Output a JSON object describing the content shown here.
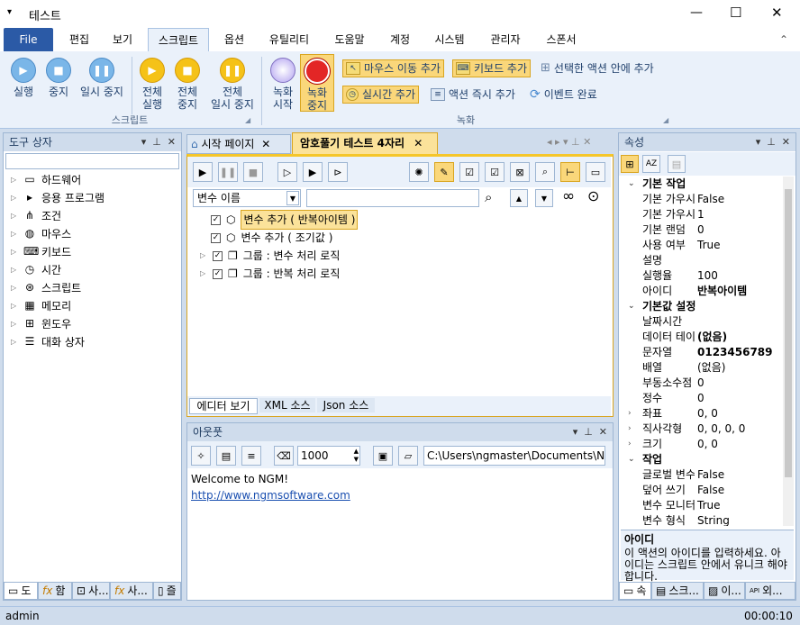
{
  "window": {
    "title": "테스트",
    "menu_glyph": "▾",
    "min": "—",
    "max": "☐",
    "close": "✕"
  },
  "ribbon_tabs": {
    "file": "File",
    "edit": "편집",
    "view": "보기",
    "script": "스크립트",
    "options": "옵션",
    "utility": "유틸리티",
    "help": "도움말",
    "account": "계정",
    "system": "시스템",
    "admin": "관리자",
    "sponsor": "스폰서",
    "collapse": "⌃"
  },
  "ribbon": {
    "run": "실행",
    "stop": "중지",
    "pause": "일시 중지",
    "all_run": [
      "전체",
      "실행"
    ],
    "all_stop": [
      "전체",
      "중지"
    ],
    "all_pause": [
      "전체",
      "일시 중지"
    ],
    "script_group": "스크립트",
    "rec_start": [
      "녹화",
      "시작"
    ],
    "rec_stop": [
      "녹화",
      "중지"
    ],
    "add_mouse": "마우스 이동 추가",
    "add_key": "키보드 추가",
    "add_after": "선택한 액션 안에 추가",
    "add_realtime": "실시간 추가",
    "action_now": "액션 즉시 추가",
    "event_done": "이벤트 완료",
    "rec_group": "녹화"
  },
  "toolbox": {
    "title": "도구 상자",
    "items": [
      "하드웨어",
      "응용 프로그램",
      "조건",
      "마우스",
      "키보드",
      "시간",
      "스크립트",
      "메모리",
      "윈도우",
      "대화 상자"
    ],
    "bottom_tabs": [
      "도",
      "함",
      "사...",
      "사...",
      "즐"
    ]
  },
  "doc_tabs": {
    "start": "시작 페이지",
    "active": "암호풀기 테스트 4자리"
  },
  "editor": {
    "var_select": "변수 이름",
    "search_value": "",
    "nodes": [
      {
        "label": "변수 추가 ( 반복아이템 )",
        "selected": true
      },
      {
        "label": "변수 추가 ( 조기값 )"
      },
      {
        "label": "그룹 : 변수 처리 로직"
      },
      {
        "label": "그룹 : 반복 처리 로직"
      }
    ],
    "tabs": [
      "에디터 보기",
      "XML 소스",
      "Json 소스"
    ]
  },
  "output": {
    "title": "아웃풋",
    "count": "1000",
    "path": "C:\\Users\\ngmaster\\Documents\\NGM",
    "lines": [
      "Welcome to NGM!"
    ],
    "link": "http://www.ngmsoftware.com"
  },
  "properties": {
    "title": "속성",
    "categories": [
      {
        "name": "기본 작업",
        "rows": [
          [
            "기본 가우시",
            "False"
          ],
          [
            "기본 가우시",
            "1"
          ],
          [
            "기본 랜덤",
            "0"
          ],
          [
            "사용 여부",
            "True"
          ],
          [
            "설명",
            ""
          ],
          [
            "실행율",
            "100"
          ],
          [
            "아이디",
            "반복아이템"
          ]
        ]
      },
      {
        "name": "기본값 설정",
        "rows": [
          [
            "날짜시간",
            ""
          ],
          [
            "데이터 테이",
            "(없음)"
          ],
          [
            "문자열",
            "0123456789"
          ],
          [
            "배열",
            "(없음)"
          ],
          [
            "부동소수점",
            "0"
          ],
          [
            "정수",
            "0"
          ],
          [
            "좌표",
            "0, 0"
          ],
          [
            "직사각형",
            "0, 0, 0, 0"
          ],
          [
            "크기",
            "0, 0"
          ]
        ]
      },
      {
        "name": "작업",
        "rows": [
          [
            "글로벌 변수",
            "False"
          ],
          [
            "덮어 쓰기",
            "False"
          ],
          [
            "변수 모니터",
            "True"
          ],
          [
            "변수 형식",
            "String"
          ]
        ]
      }
    ],
    "desc_title": "아이디",
    "desc_text": "이 액션의 아이디를 입력하세요. 아이디는 스크립트 안에서 유니크 해야 합니다.",
    "bottom_tabs": [
      "속",
      "스크...",
      "이...",
      "외..."
    ]
  },
  "status": {
    "user": "admin",
    "time": "00:00:10"
  }
}
